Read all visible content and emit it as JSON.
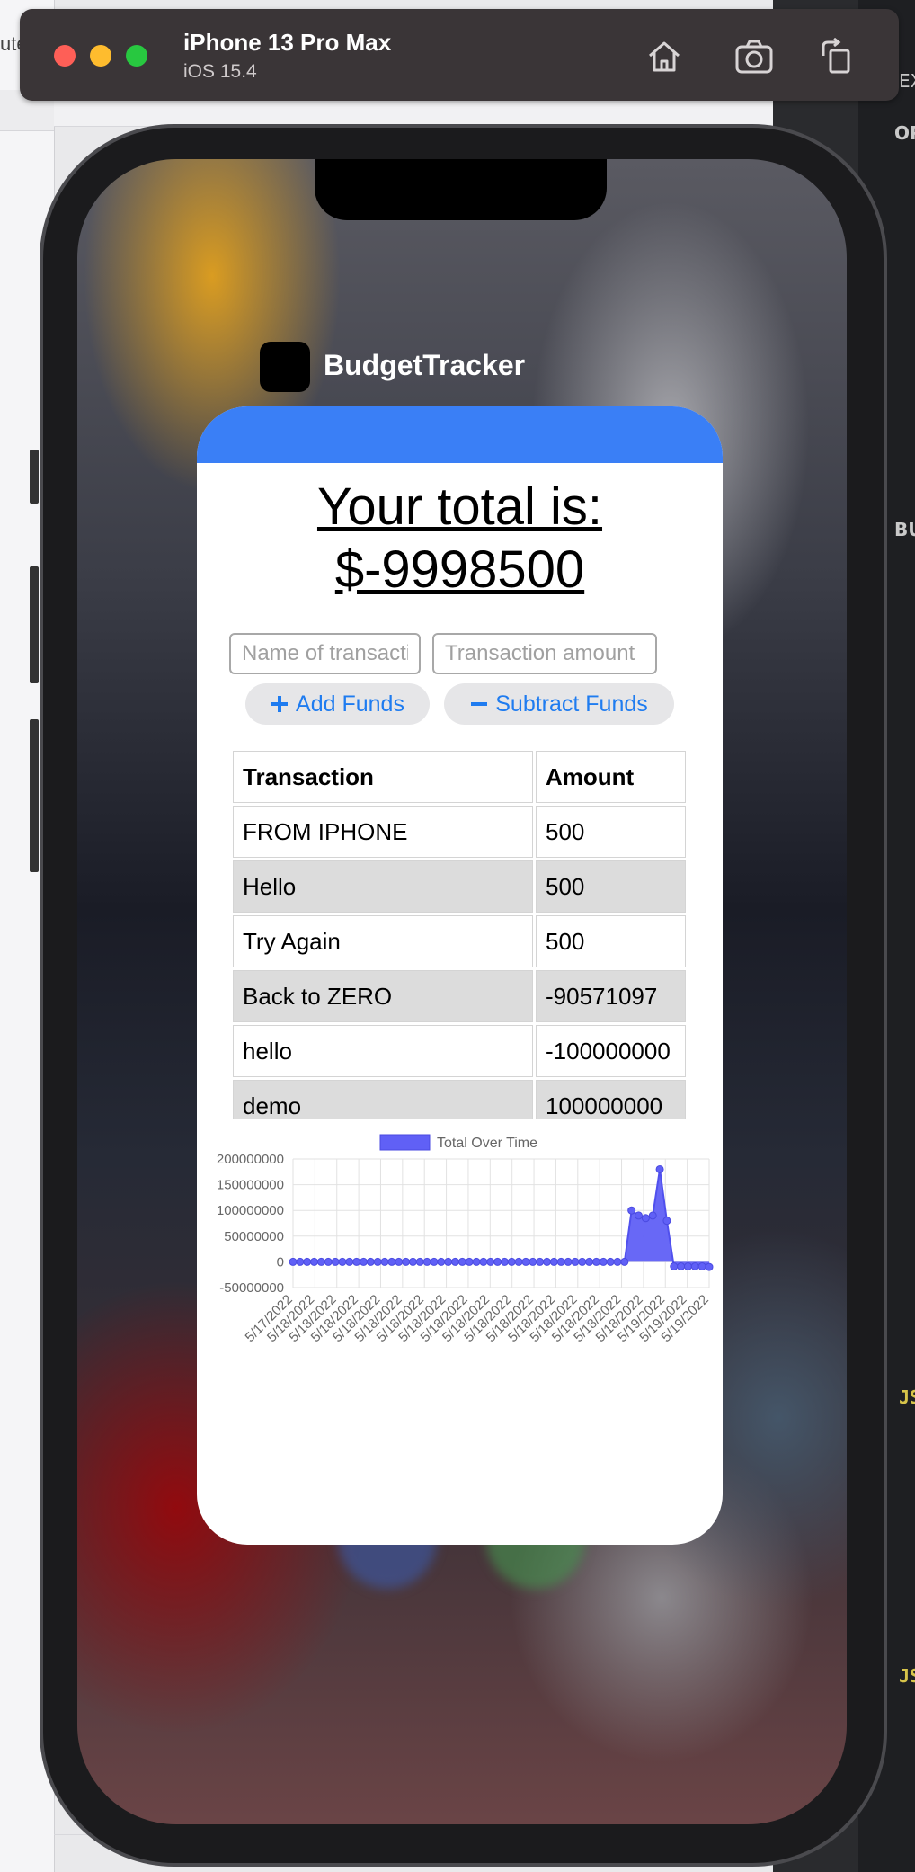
{
  "simulator": {
    "device": "iPhone 13 Pro Max",
    "os": "iOS 15.4"
  },
  "background": {
    "left_text": "ute",
    "right_items": [
      "EX",
      "OP",
      "BU",
      "JS",
      "JS"
    ]
  },
  "app": {
    "name": "BudgetTracker",
    "total_line1": "Your total is:",
    "total_line2": "$-9998500",
    "name_placeholder": "Name of transaction",
    "amount_placeholder": "Transaction amount",
    "add_label": "Add Funds",
    "subtract_label": "Subtract Funds",
    "table": {
      "headers": [
        "Transaction",
        "Amount"
      ],
      "rows": [
        [
          "FROM IPHONE",
          "500"
        ],
        [
          "Hello",
          "500"
        ],
        [
          "Try Again",
          "500"
        ],
        [
          "Back to ZERO",
          "-90571097"
        ],
        [
          "hello",
          "-100000000"
        ],
        [
          "demo",
          "100000000"
        ]
      ]
    }
  },
  "chart_data": {
    "type": "area",
    "legend": "Total Over Time",
    "color": "#6060f6",
    "ylim": [
      -50000000,
      200000000
    ],
    "yticks": [
      200000000,
      150000000,
      100000000,
      50000000,
      0,
      -50000000
    ],
    "x": [
      "5/17/2022",
      "5/18/2022",
      "5/18/2022",
      "5/18/2022",
      "5/18/2022",
      "5/18/2022",
      "5/18/2022",
      "5/18/2022",
      "5/18/2022",
      "5/18/2022",
      "5/18/2022",
      "5/18/2022",
      "5/18/2022",
      "5/18/2022",
      "5/18/2022",
      "5/18/2022",
      "5/18/2022",
      "5/19/2022",
      "5/19/2022",
      "5/19/2022"
    ],
    "values": [
      0,
      0,
      0,
      0,
      0,
      0,
      0,
      0,
      0,
      0,
      0,
      0,
      0,
      0,
      0,
      0,
      0,
      0,
      0,
      0,
      0,
      0,
      0,
      0,
      0,
      0,
      0,
      0,
      0,
      0,
      0,
      0,
      0,
      0,
      0,
      0,
      0,
      0,
      0,
      0,
      0,
      0,
      0,
      0,
      0,
      0,
      0,
      0,
      100000000,
      90000000,
      85000000,
      90000000,
      180000000,
      80000000,
      -9000000,
      -9000000,
      -9000000,
      -9000000,
      -9000000,
      -9998500
    ]
  }
}
